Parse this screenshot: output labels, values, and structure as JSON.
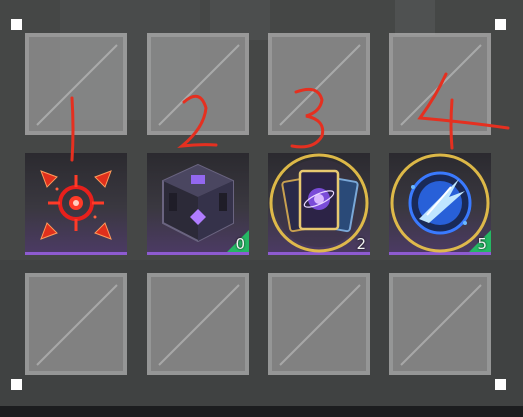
{
  "inventory": {
    "rows": 3,
    "cols": 4,
    "items": [
      {
        "name": "crosshair-target",
        "icon": "crosshair-icon",
        "count": "",
        "badge": false
      },
      {
        "name": "dark-cube",
        "icon": "cube-icon",
        "count": "0",
        "badge": true
      },
      {
        "name": "card-deck",
        "icon": "cards-icon",
        "count": "2",
        "badge": false
      },
      {
        "name": "blue-orb",
        "icon": "orb-icon",
        "count": "5",
        "badge": true
      }
    ]
  },
  "annotations": [
    "1",
    "2",
    "3",
    "4"
  ],
  "colors": {
    "empty_slot": "#9a9a9a",
    "badge_green": "#25b864",
    "accent_purple": "#8e5bd1",
    "annotation_red": "#e53020"
  }
}
